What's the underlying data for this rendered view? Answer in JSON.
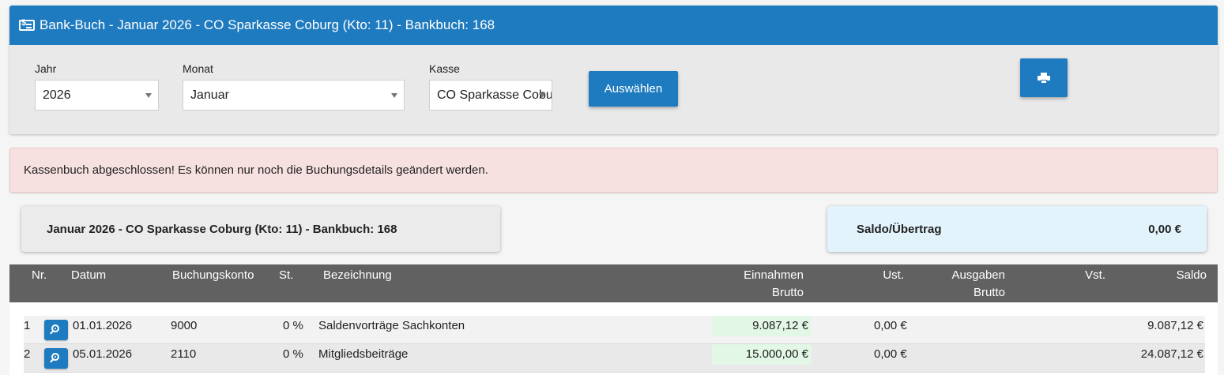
{
  "header": {
    "title": "Bank-Buch - Januar 2026 - CO Sparkasse Coburg (Kto: 11) - Bankbuch: 168"
  },
  "filters": {
    "year": {
      "label": "Jahr",
      "value": "2026"
    },
    "month": {
      "label": "Monat",
      "value": "Januar"
    },
    "cash": {
      "label": "Kasse",
      "value": "CO Sparkasse Coburg"
    },
    "select_button": "Auswählen"
  },
  "alert": {
    "text": "Kassenbuch abgeschlossen! Es können nur noch die Buchungsdetails geändert werden."
  },
  "summary": {
    "title": "Januar 2026 - CO Sparkasse Coburg (Kto: 11) - Bankbuch: 168",
    "balance_label": "Saldo/Übertrag",
    "balance_value": "0,00 €"
  },
  "table": {
    "headers": {
      "nr": "Nr.",
      "date": "Datum",
      "account": "Buchungskonto",
      "tax": "St.",
      "description": "Bezeichnung",
      "income_1": "Einnahmen",
      "income_2": "Brutto",
      "vat": "Ust.",
      "expense_1": "Ausgaben",
      "expense_2": "Brutto",
      "input_tax": "Vst.",
      "balance": "Saldo"
    },
    "rows": [
      {
        "nr": "1",
        "date": "01.01.2026",
        "account": "9000",
        "tax": "0 %",
        "description": "Saldenvorträge Sachkonten",
        "income": "9.087,12 €",
        "vat": "0,00 €",
        "expense": "",
        "input_tax": "",
        "balance": "9.087,12 €"
      },
      {
        "nr": "2",
        "date": "05.01.2026",
        "account": "2110",
        "tax": "0 %",
        "description": "Mitgliedsbeiträge",
        "income": "15.000,00 €",
        "vat": "0,00 €",
        "expense": "",
        "input_tax": "",
        "balance": "24.087,12 €"
      }
    ]
  },
  "colors": {
    "primary": "#1f7bbf",
    "header_bg": "#616161",
    "alert_bg": "#f7e1e0",
    "income_bg": "#e2f7e5",
    "balance_card_bg": "#e3f3fc"
  }
}
